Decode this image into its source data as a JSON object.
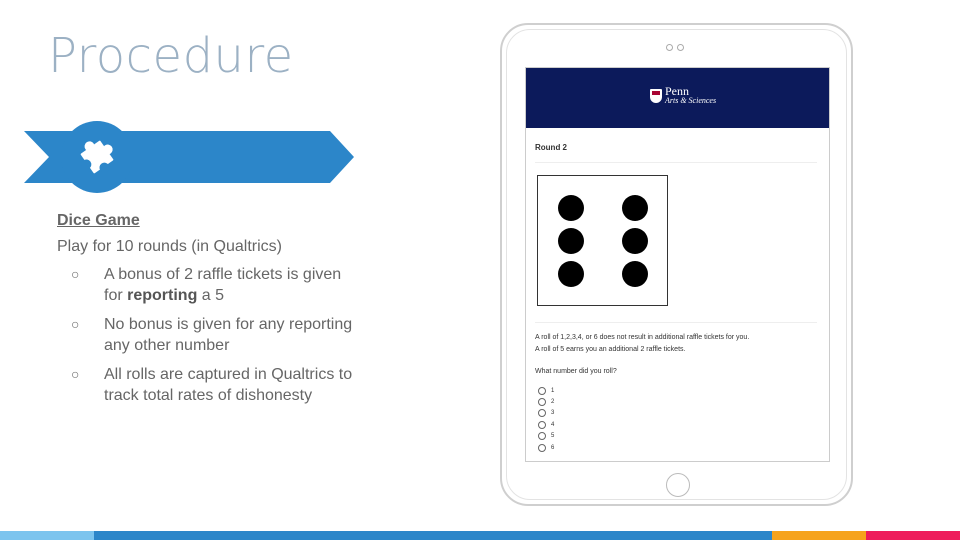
{
  "slide": {
    "title": "Procedure",
    "subhead": "Dice Game",
    "lead": "Play for 10 rounds (in Qualtrics)",
    "bullet_symbol": "○",
    "bullets": [
      {
        "before": "A bonus of 2 raffle tickets is given for ",
        "bold": "reporting",
        "after": " a 5"
      },
      {
        "before": "No bonus is given for any reporting any other number",
        "bold": "",
        "after": ""
      },
      {
        "before": "All rolls are captured in Qualtrics to track total rates of dishonesty",
        "bold": "",
        "after": ""
      }
    ],
    "banner_icon": "puzzle-piece-icon"
  },
  "survey": {
    "brand_line1": "Penn",
    "brand_line2": "Arts & Sciences",
    "round_label": "Round 2",
    "die_value": 6,
    "info_line1": "A roll of 1,2,3,4, or 6 does not result in additional raffle tickets for you.",
    "info_line2": "A roll of 5 earns you an additional 2 raffle tickets.",
    "question": "What number did you roll?",
    "options": [
      "1",
      "2",
      "3",
      "4",
      "5",
      "6"
    ]
  },
  "colors": {
    "title": "#9cb1c4",
    "banner": "#2c86c9",
    "header_navy": "#0c1a5b",
    "footer": [
      "#7cc4ee",
      "#2c86c9",
      "#f6a31c",
      "#ee1c5b"
    ]
  }
}
